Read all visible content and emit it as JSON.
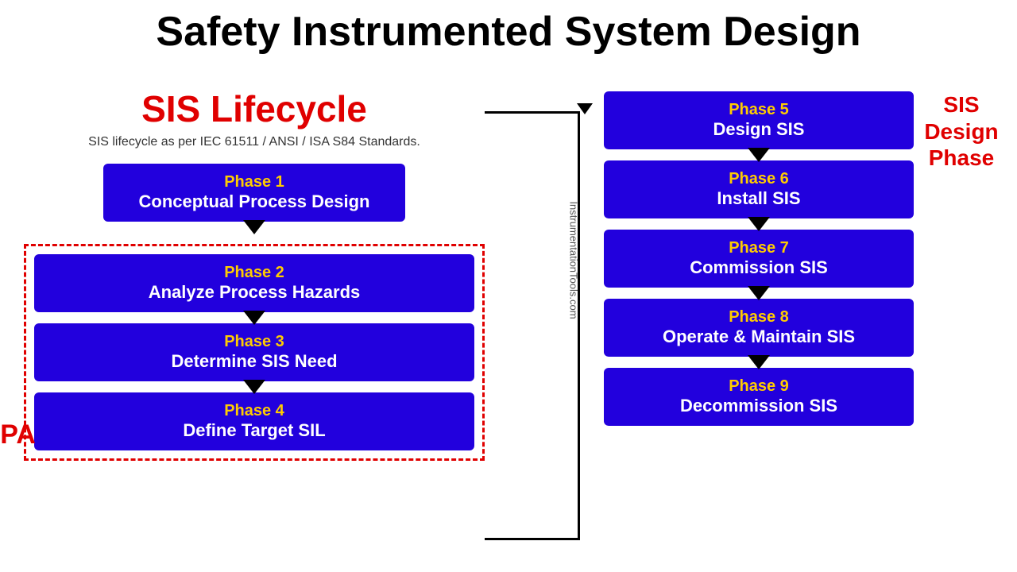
{
  "title": "Safety Instrumented System Design",
  "left": {
    "lifecycle_title": "SIS Lifecycle",
    "subtitle": "SIS lifecycle as per IEC 61511 / ANSI / ISA S84 Standards.",
    "lopa": "LOPA",
    "phase1_label": "Phase 1",
    "phase1_name": "Conceptual Process Design",
    "phase2_label": "Phase 2",
    "phase2_name": "Analyze Process Hazards",
    "phase3_label": "Phase 3",
    "phase3_name": "Determine SIS Need",
    "phase4_label": "Phase 4",
    "phase4_name": "Define Target SIL"
  },
  "right": {
    "sis_design": "SIS Design Phase",
    "phase5_label": "Phase 5",
    "phase5_name": "Design SIS",
    "phase6_label": "Phase 6",
    "phase6_name": "Install SIS",
    "phase7_label": "Phase 7",
    "phase7_name": "Commission SIS",
    "phase8_label": "Phase 8",
    "phase8_name": "Operate & Maintain SIS",
    "phase9_label": "Phase 9",
    "phase9_name": "Decommission SIS"
  },
  "watermark": "InstrumentationTools.com"
}
